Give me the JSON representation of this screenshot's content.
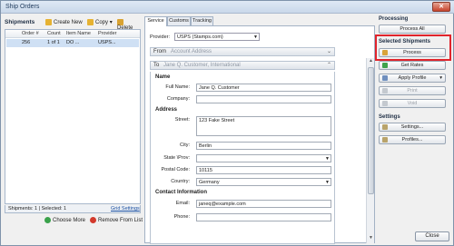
{
  "window": {
    "title": "Ship Orders",
    "close_glyph": "✕"
  },
  "shipments": {
    "header": "Shipments",
    "toolbar": {
      "create_new": "Create New",
      "copy": "Copy",
      "delete": "Delete"
    },
    "columns": [
      "Order #",
      "Count",
      "Item Name",
      "Provider"
    ],
    "rows": [
      {
        "order": "256",
        "count": "1 of 1",
        "item": "DO ...",
        "provider": "USPS..."
      }
    ],
    "footer": {
      "status": "Shipments: 1 | Selected: 1",
      "grid_settings": "Grid Settings"
    },
    "choose_more": "Choose More",
    "remove_from_list": "Remove From List"
  },
  "tabs": [
    "Service",
    "Customs",
    "Tracking"
  ],
  "service": {
    "provider_label": "Provider:",
    "provider_value": "USPS (Stamps.com)",
    "from_label": "From",
    "from_value": "Account Address",
    "to_label": "To",
    "to_value": "Jane Q. Customer, International",
    "name_section": "Name",
    "full_name_label": "Full Name:",
    "full_name_value": "Jane Q. Customer",
    "company_label": "Company:",
    "company_value": "",
    "address_section": "Address",
    "street_label": "Street:",
    "street_value": "123 Fake Street",
    "city_label": "City:",
    "city_value": "Berlin",
    "state_label": "State \\Prov:",
    "state_value": "",
    "postal_label": "Postal Code:",
    "postal_value": "10115",
    "country_label": "Country:",
    "country_value": "Germany",
    "contact_section": "Contact Information",
    "email_label": "Email:",
    "email_value": "janeq@example.com",
    "phone_label": "Phone:",
    "phone_value": ""
  },
  "right_panel": {
    "processing_header": "Processing",
    "process_all": "Process All",
    "selected_header": "Selected Shipments",
    "process": "Process",
    "get_rates": "Get Rates",
    "apply_profile": "Apply Profile",
    "print": "Print",
    "void": "Void",
    "settings_header": "Settings",
    "settings": "Settings...",
    "profiles": "Profiles..."
  },
  "close_button": "Close",
  "colors": {
    "highlight": "#e0242c",
    "selection": "#cfe0f4"
  },
  "icons": [
    "create-new-icon",
    "copy-icon",
    "delete-icon",
    "choose-more-icon",
    "remove-icon",
    "process-icon",
    "get-rates-icon",
    "apply-profile-icon",
    "print-icon",
    "void-icon",
    "settings-icon",
    "profiles-icon"
  ]
}
